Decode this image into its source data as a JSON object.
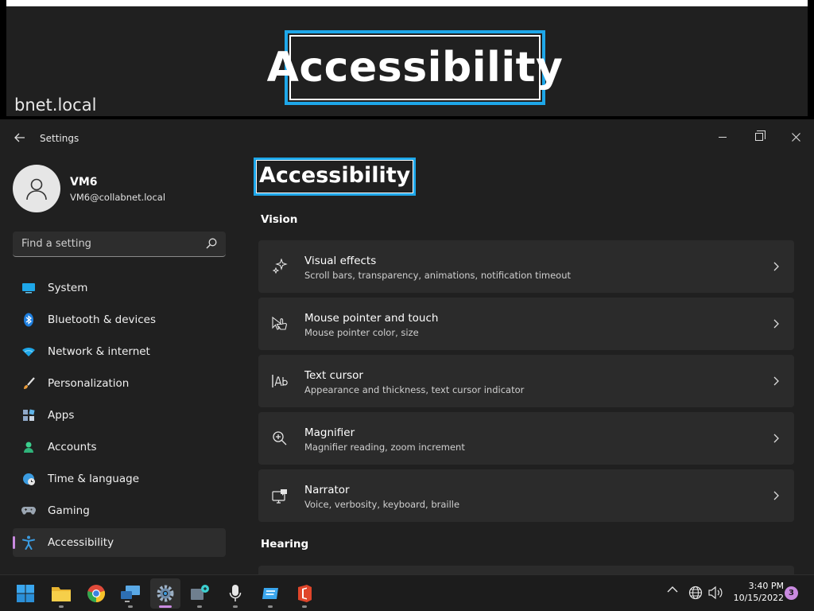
{
  "banner": {
    "title": "Accessibility",
    "host": "bnet.local"
  },
  "window": {
    "app_title": "Settings",
    "back_icon": "arrow-left-icon",
    "controls": [
      "minimize-icon",
      "maximize-icon",
      "close-icon"
    ]
  },
  "profile": {
    "name": "VM6",
    "email": "VM6@collabnet.local"
  },
  "search": {
    "placeholder": "Find a setting"
  },
  "sidebar": {
    "items": [
      {
        "label": "System",
        "icon": "monitor-icon",
        "active": false
      },
      {
        "label": "Bluetooth & devices",
        "icon": "bluetooth-icon",
        "active": false
      },
      {
        "label": "Network & internet",
        "icon": "wifi-icon",
        "active": false
      },
      {
        "label": "Personalization",
        "icon": "brush-icon",
        "active": false
      },
      {
        "label": "Apps",
        "icon": "apps-icon",
        "active": false
      },
      {
        "label": "Accounts",
        "icon": "person-icon",
        "active": false
      },
      {
        "label": "Time & language",
        "icon": "globe-clock-icon",
        "active": false
      },
      {
        "label": "Gaming",
        "icon": "gamepad-icon",
        "active": false
      },
      {
        "label": "Accessibility",
        "icon": "accessibility-icon",
        "active": true
      }
    ]
  },
  "main": {
    "title": "Accessibility",
    "vision_heading": "Vision",
    "hearing_heading": "Hearing",
    "cards": [
      {
        "title": "Visual effects",
        "subtitle": "Scroll bars, transparency, animations, notification timeout",
        "icon": "sparkle-icon"
      },
      {
        "title": "Mouse pointer and touch",
        "subtitle": "Mouse pointer color, size",
        "icon": "pointer-touch-icon"
      },
      {
        "title": "Text cursor",
        "subtitle": "Appearance and thickness, text cursor indicator",
        "icon": "text-cursor-icon"
      },
      {
        "title": "Magnifier",
        "subtitle": "Magnifier reading, zoom increment",
        "icon": "magnifier-icon"
      },
      {
        "title": "Narrator",
        "subtitle": "Voice, verbosity, keyboard, braille",
        "icon": "narrator-icon"
      }
    ]
  },
  "taskbar": {
    "apps": [
      "start-icon",
      "file-explorer-icon",
      "chrome-icon",
      "remote-desktop-icon",
      "settings-icon",
      "connect-icon",
      "microphone-icon",
      "app-window-icon",
      "office-icon"
    ],
    "active_app": "settings-icon",
    "time": "3:40 PM",
    "date": "10/15/2022",
    "notification_count": "3"
  },
  "colors": {
    "accent": "#1ea7e9",
    "active_indicator": "#c98ae0",
    "window_bg": "#202020",
    "card_bg": "#2b2b2b"
  }
}
